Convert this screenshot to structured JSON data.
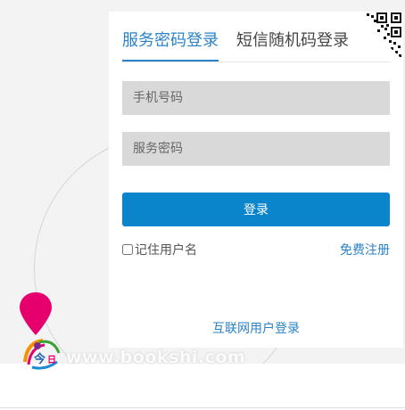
{
  "tabs": [
    {
      "label": "服务密码登录",
      "active": true
    },
    {
      "label": "短信随机码登录",
      "active": false
    }
  ],
  "form": {
    "phone_placeholder": "手机号码",
    "password_placeholder": "服务密码",
    "login_label": "登录",
    "remember_label": "记住用户名",
    "register_label": "免费注册",
    "internet_login_label": "互联网用户登录"
  },
  "icons": {
    "qr": "qr-code-icon",
    "pin": "map-pin-icon",
    "logo": "site-logo"
  },
  "watermark": "www.bookshi.com",
  "colors": {
    "accent": "#2a83c6",
    "button": "#0a84cb",
    "field_bg": "#d9d9d9",
    "pin": "#e5006e"
  }
}
